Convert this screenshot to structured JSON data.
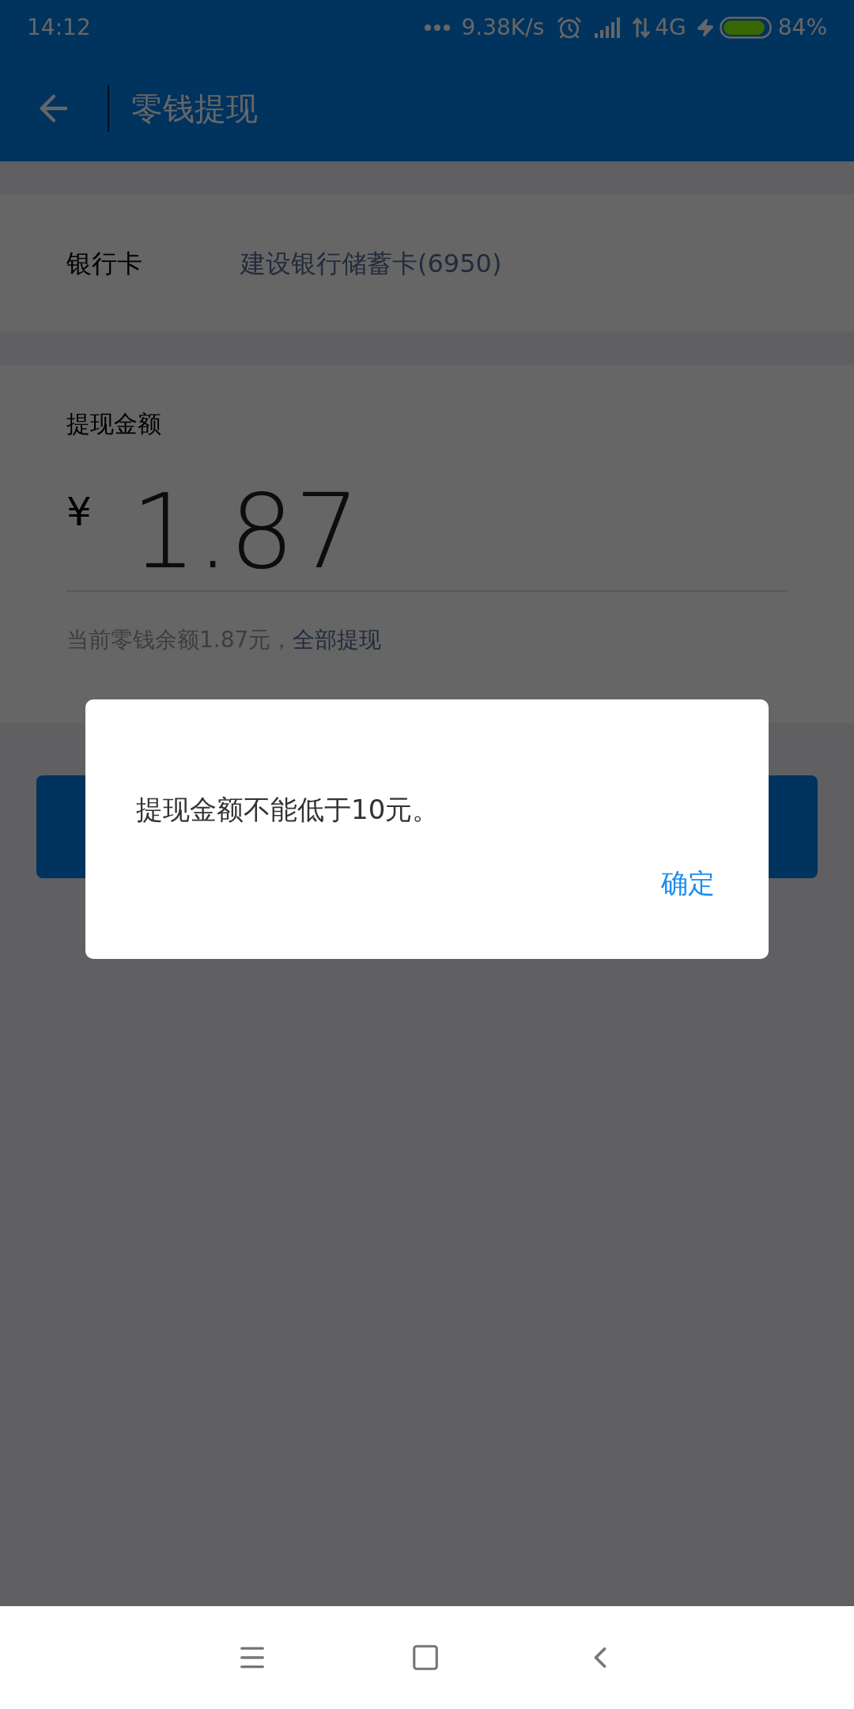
{
  "status_bar": {
    "time": "14:12",
    "network_speed": "9.38K/s",
    "network": "4G",
    "battery": "84%"
  },
  "app_bar": {
    "title": "零钱提现"
  },
  "bank_card": {
    "label": "银行卡",
    "value": "建设银行储蓄卡(6950)"
  },
  "amount": {
    "label": "提现金额",
    "currency": "¥",
    "value": "1.87",
    "balance_note": "当前零钱余额1.87元，",
    "withdraw_all_link": "全部提现"
  },
  "dialog": {
    "message": "提现金额不能低于10元。",
    "buttons": [
      "确定"
    ]
  }
}
